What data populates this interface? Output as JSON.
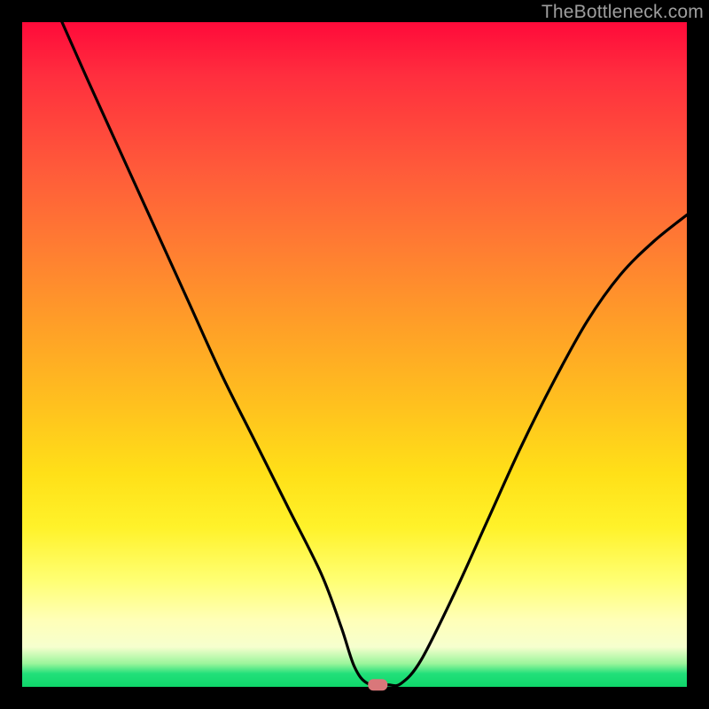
{
  "watermark": "TheBottleneck.com",
  "chart_data": {
    "type": "line",
    "title": "",
    "xlabel": "",
    "ylabel": "",
    "xlim": [
      0,
      100
    ],
    "ylim": [
      0,
      100
    ],
    "series": [
      {
        "name": "bottleneck-curve",
        "x": [
          6,
          10,
          15,
          20,
          25,
          30,
          35,
          40,
          45,
          48,
          50,
          52,
          55,
          57,
          60,
          65,
          70,
          75,
          80,
          85,
          90,
          95,
          100
        ],
        "y": [
          100,
          91,
          80,
          69,
          58,
          47,
          37,
          27,
          17,
          9,
          3,
          0.5,
          0.3,
          0.5,
          4,
          14,
          25,
          36,
          46,
          55,
          62,
          67,
          71
        ]
      }
    ],
    "marker": {
      "name": "optimal-point",
      "x": 53.5,
      "y": 0.3
    },
    "gradient_stops": [
      {
        "pct": 0,
        "color": "#ff0a3a"
      },
      {
        "pct": 50,
        "color": "#ffb020"
      },
      {
        "pct": 80,
        "color": "#ffff66"
      },
      {
        "pct": 100,
        "color": "#0fd66a"
      }
    ]
  }
}
